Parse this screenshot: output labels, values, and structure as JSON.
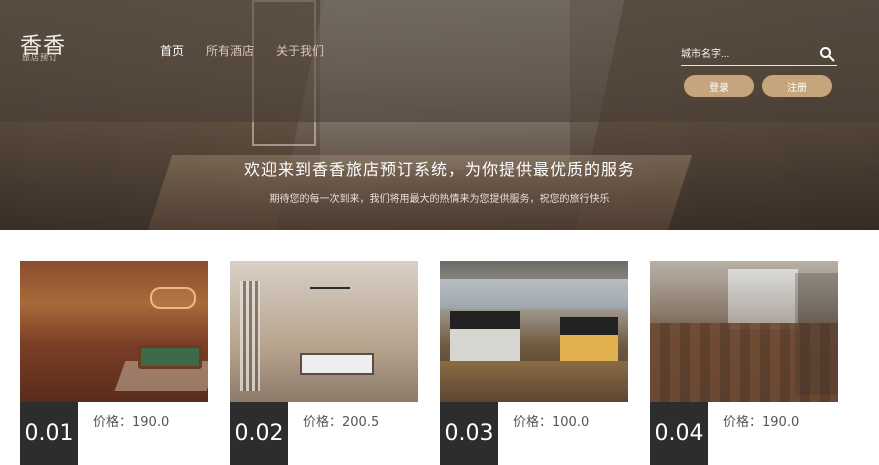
{
  "brand": {
    "main": "香香",
    "sub": "旅店预订"
  },
  "nav": {
    "items": [
      "首页",
      "所有酒店",
      "关于我们"
    ]
  },
  "search": {
    "placeholder": "城市名字..."
  },
  "auth": {
    "login": "登录",
    "register": "注册"
  },
  "hero": {
    "title": "欢迎来到香香旅店预订系统，为你提供最优质的服务",
    "subtitle": "期待您的每一次到来，我们将用最大的热情来为您提供服务，祝您的旅行快乐"
  },
  "cards": [
    {
      "code": "0.01",
      "price_label": "价格：190.0"
    },
    {
      "code": "0.02",
      "price_label": "价格：200.5"
    },
    {
      "code": "0.03",
      "price_label": "价格：100.0"
    },
    {
      "code": "0.04",
      "price_label": "价格：190.0"
    }
  ],
  "colors": {
    "accent": "#c6a57c",
    "code_bg": "#2d2d2d"
  },
  "icons": {
    "search": "search-icon"
  }
}
